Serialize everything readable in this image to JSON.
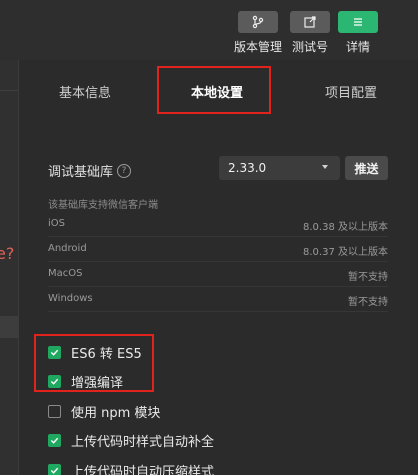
{
  "toolbar": {
    "buttons": [
      {
        "label": "版本管理",
        "icon": "branch-icon"
      },
      {
        "label": "测试号",
        "icon": "external-link-icon"
      },
      {
        "label": "详情",
        "icon": "menu-icon"
      }
    ]
  },
  "left_fragment": {
    "text": "e?"
  },
  "tabs": [
    {
      "label": "基本信息",
      "active": false
    },
    {
      "label": "本地设置",
      "active": true
    },
    {
      "label": "项目配置",
      "active": false
    }
  ],
  "library": {
    "label": "调试基础库",
    "help_icon": "?",
    "version": "2.33.0",
    "push_label": "推送",
    "support_title": "该基础库支持微信客户端",
    "platforms": [
      {
        "name": "iOS",
        "value": "8.0.38 及以上版本"
      },
      {
        "name": "Android",
        "value": "8.0.37 及以上版本"
      },
      {
        "name": "MacOS",
        "value": "暂不支持"
      },
      {
        "name": "Windows",
        "value": "暂不支持"
      }
    ]
  },
  "options": [
    {
      "label": "ES6 转 ES5",
      "checked": true
    },
    {
      "label": "增强编译",
      "checked": true
    },
    {
      "label": "使用 npm 模块",
      "checked": false
    },
    {
      "label": "上传代码时样式自动补全",
      "checked": true
    },
    {
      "label": "上传代码时自动压缩样式",
      "checked": true
    }
  ],
  "colors": {
    "accent_green": "#2bb672",
    "checkbox_green": "#1fa85f",
    "annotation_red": "#e0231c",
    "background": "#2b2b2b"
  }
}
